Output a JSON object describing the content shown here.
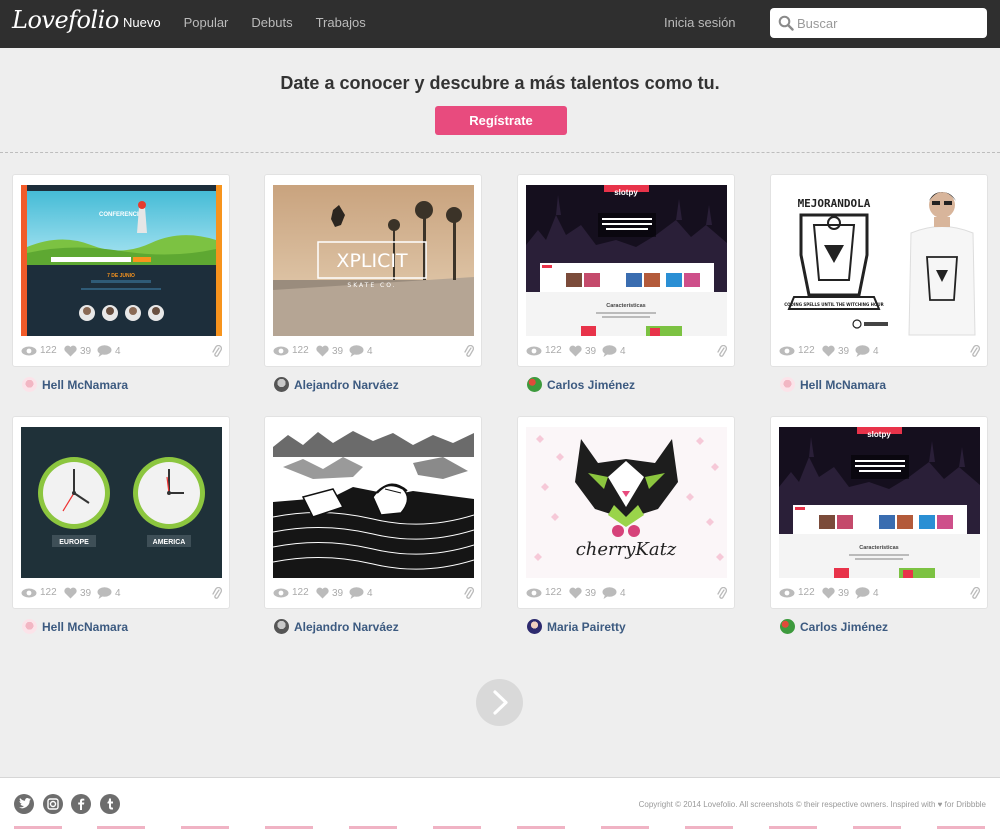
{
  "header": {
    "logo": "Lovefolio",
    "nav": [
      {
        "label": "Nuevo",
        "active": true
      },
      {
        "label": "Popular",
        "active": false
      },
      {
        "label": "Debuts",
        "active": false
      },
      {
        "label": "Trabajos",
        "active": false
      }
    ],
    "login": "Inicia sesión",
    "search_placeholder": "Buscar"
  },
  "hero": {
    "title": "Date a conocer y descubre a más talentos como tu.",
    "signup": "Regístrate"
  },
  "cards": [
    {
      "views": "122",
      "likes": "39",
      "comments": "4",
      "author": "Hell McNamara"
    },
    {
      "views": "122",
      "likes": "39",
      "comments": "4",
      "author": "Alejandro Narváez"
    },
    {
      "views": "122",
      "likes": "39",
      "comments": "4",
      "author": "Carlos Jiménez"
    },
    {
      "views": "122",
      "likes": "39",
      "comments": "4",
      "author": "Hell McNamara"
    },
    {
      "views": "122",
      "likes": "39",
      "comments": "4",
      "author": "Hell McNamara"
    },
    {
      "views": "122",
      "likes": "39",
      "comments": "4",
      "author": "Alejandro Narváez"
    },
    {
      "views": "122",
      "likes": "39",
      "comments": "4",
      "author": "Maria Pairetty"
    },
    {
      "views": "122",
      "likes": "39",
      "comments": "4",
      "author": "Carlos Jiménez"
    }
  ],
  "thumbs": {
    "conference_title": "CONFERENCIA",
    "conference_date": "7 DE JUNIO",
    "xplicit": "XPLICIT",
    "skate": "SKATE CO.",
    "slot_brand": "slotpy",
    "slot_headline": "Música donde quieras! proyecto open source desarrollado en los cursos de mejorandola",
    "slot_features": "Características",
    "mejorandola": "MEJORANDOLA",
    "coding_spells": "CODING SPELLS UNTIL THE WITCHING HOUR",
    "europe": "EUROPE",
    "america": "AMERICA",
    "cherry": "cherryKatz"
  },
  "footer": {
    "social": [
      "twitter-icon",
      "instagram-icon",
      "facebook-icon",
      "tumblr-icon"
    ],
    "copyright": "Copyright © 2014 Lovefolio. All screenshots © their respective owners. Inspired with ♥ for Dribbble"
  },
  "colors": {
    "header_bg": "#2f2f2f",
    "accent": "#e84b7e",
    "author_link": "#3c5a80",
    "page_bg": "#eeeeee"
  }
}
